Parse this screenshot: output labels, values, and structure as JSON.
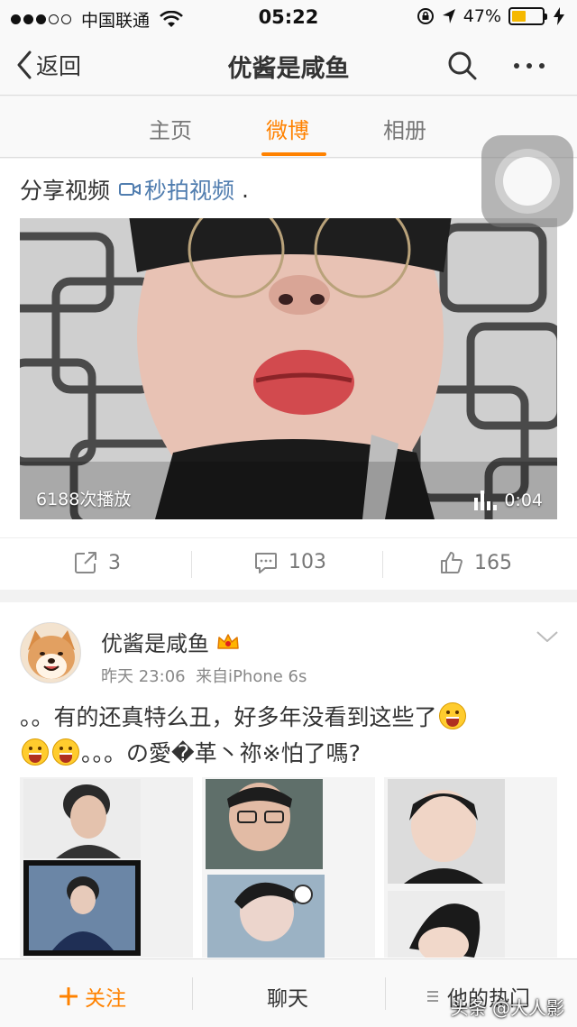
{
  "status_bar": {
    "carrier": "中国联通",
    "time": "05:22",
    "battery": "47%",
    "battery_level": 0.47
  },
  "nav": {
    "back_label": "返回",
    "title": "优酱是咸鱼"
  },
  "tabs": [
    {
      "label": "主页",
      "active": false
    },
    {
      "label": "微博",
      "active": true
    },
    {
      "label": "相册",
      "active": false
    }
  ],
  "post1": {
    "text": "分享视频",
    "link_label": "秒拍视频",
    "trailing": ".",
    "video": {
      "plays": "6188次播放",
      "duration": "0:04"
    },
    "actions": {
      "reposts": "3",
      "comments": "103",
      "likes": "165"
    }
  },
  "post2": {
    "author": "优酱是咸鱼",
    "time": "昨天 23:06",
    "source": "来自iPhone 6s",
    "text_part1": "。。有的还真特么丑，好多年没看到这些了",
    "text_part2": "。。。の愛�革丶祢※怕了嗎?"
  },
  "bottom_bar": {
    "follow": "关注",
    "chat": "聊天",
    "hot": "他的热门"
  },
  "watermark": "头条 @大人影",
  "colors": {
    "accent": "#ff8200",
    "link": "#507daf"
  }
}
